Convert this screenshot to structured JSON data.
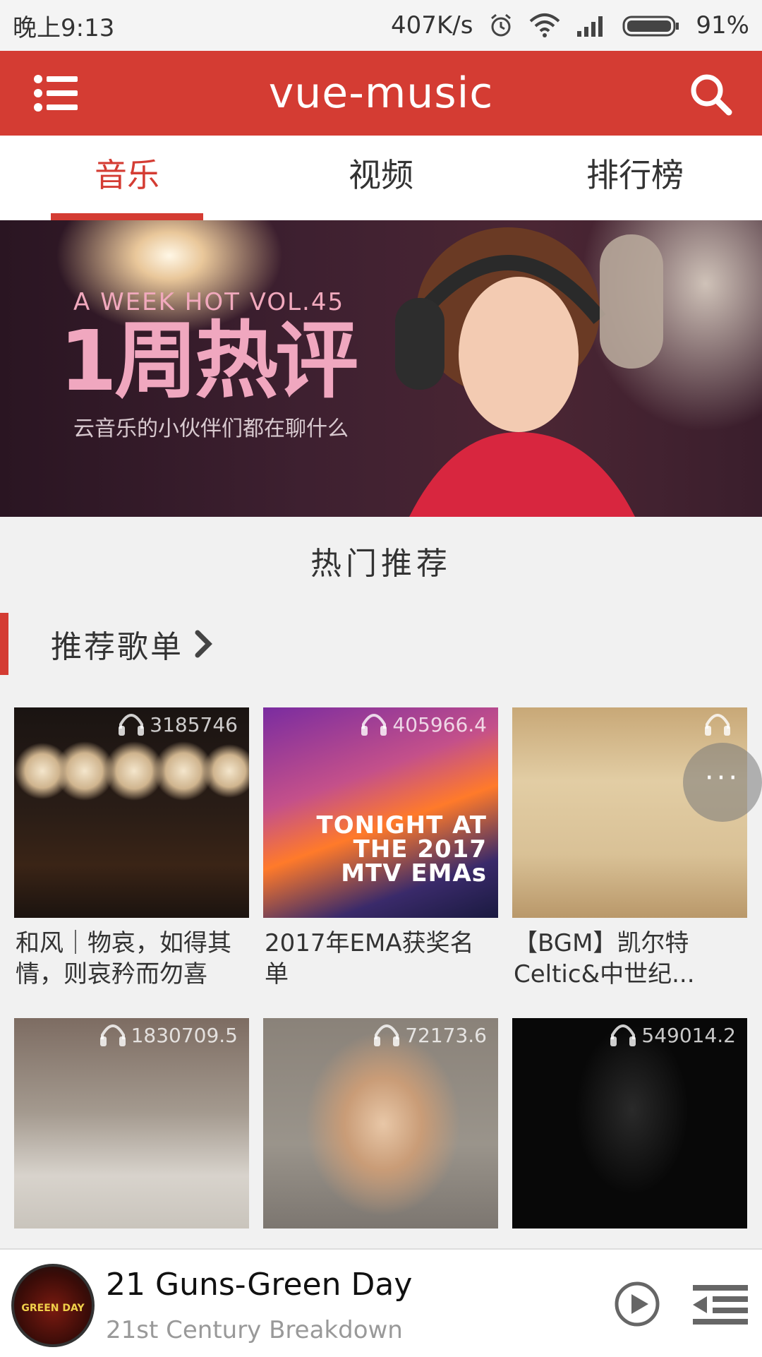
{
  "status_bar": {
    "time": "晚上9:13",
    "speed": "407K/s",
    "battery": "91%"
  },
  "header": {
    "title": "vue-music",
    "menu_icon": "menu-icon",
    "search_icon": "search-icon",
    "color": "#d43c33"
  },
  "tabs": [
    {
      "label": "音乐",
      "active": true
    },
    {
      "label": "视频",
      "active": false
    },
    {
      "label": "排行榜",
      "active": false
    }
  ],
  "banner": {
    "vol": "A WEEK HOT  VOL.45",
    "headline": "1周热评",
    "subtitle": "云音乐的小伙伴们都在聊什么",
    "dots_total": 6,
    "dots_active_index": 1
  },
  "hot": {
    "title": "热门推荐",
    "section_label": "推荐歌单"
  },
  "playlists": [
    {
      "count": "3185746",
      "name": "和风｜物哀，如得其情，则哀矜而勿喜"
    },
    {
      "count": "405966.4",
      "name": "2017年EMA获奖名单",
      "cover_text": "TONIGHT AT THE 2017 MTV EMAs"
    },
    {
      "count": "",
      "name": "【BGM】凯尔特Celtic&中世纪..."
    },
    {
      "count": "1830709.5",
      "name": ""
    },
    {
      "count": "72173.6",
      "name": ""
    },
    {
      "count": "549014.2",
      "name": ""
    }
  ],
  "more_button": "···",
  "player": {
    "title": "21 Guns-Green Day",
    "album": "21st Century Breakdown",
    "avatar_text": "GREEN DAY",
    "play_icon": "play-circle-icon",
    "playlist_icon": "playlist-icon"
  }
}
